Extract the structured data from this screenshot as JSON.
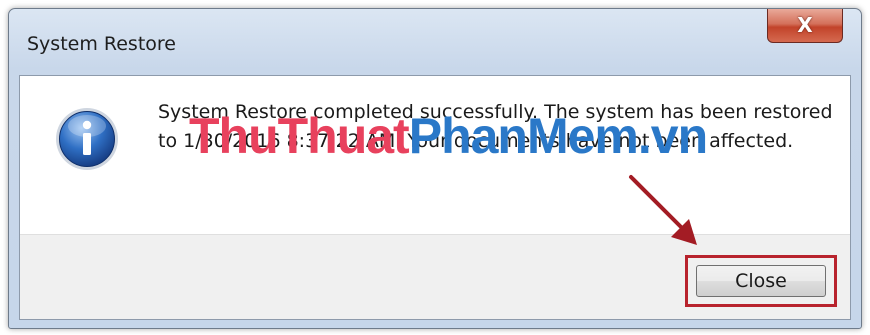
{
  "window": {
    "title": "System Restore",
    "close_glyph": "X"
  },
  "dialog": {
    "icon": "information-icon",
    "message": "System Restore completed successfully. The system has been restored to 1/30/2016 8:37:22 AM. Your documents have not been affected."
  },
  "buttons": {
    "close_label": "Close"
  },
  "watermark": {
    "part1": "ThuThuat",
    "part2": "PhanMem",
    "part3": ".vn"
  },
  "colors": {
    "title_close_red": "#c2432a",
    "highlight_red": "#b8232d",
    "watermark_pink": "#e8415d",
    "watermark_blue": "#2a78c8"
  }
}
